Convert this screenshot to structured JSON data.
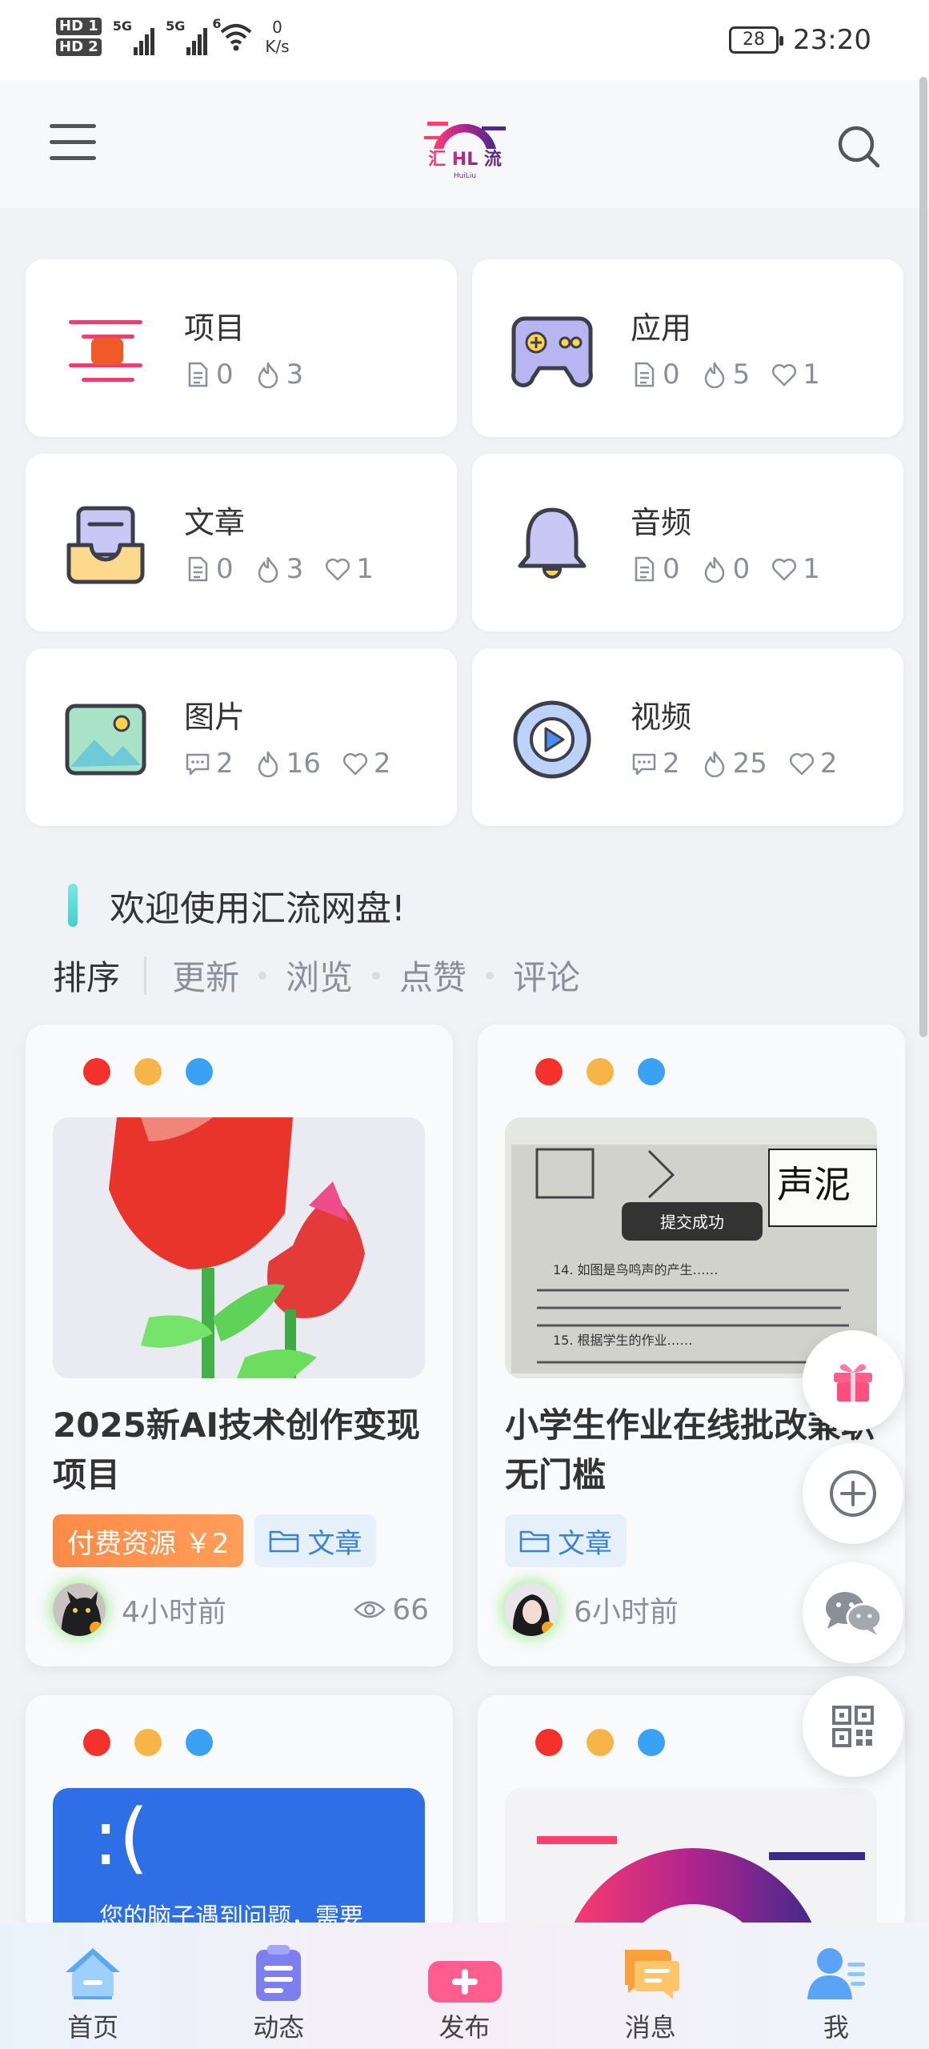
{
  "status_bar": {
    "sim1": "HD 1",
    "sim2": "HD 2",
    "network_1": "5G",
    "network_2": "5G",
    "wifi": "6",
    "net_speed_value": "0",
    "net_speed_unit": "K/s",
    "battery": "28",
    "time": "23:20"
  },
  "header": {
    "logo_text": "汇 HL 流",
    "logo_sub": "HuiLiu"
  },
  "categories": [
    {
      "title": "项目",
      "docs": "0",
      "hot": "3",
      "likes": null,
      "comments": null
    },
    {
      "title": "应用",
      "docs": "0",
      "hot": "5",
      "likes": "1",
      "comments": null
    },
    {
      "title": "文章",
      "docs": "0",
      "hot": "3",
      "likes": "1",
      "comments": null
    },
    {
      "title": "音频",
      "docs": "0",
      "hot": "0",
      "likes": "1",
      "comments": null
    },
    {
      "title": "图片",
      "docs": null,
      "hot": "16",
      "likes": "2",
      "comments": "2"
    },
    {
      "title": "视频",
      "docs": null,
      "hot": "25",
      "likes": "2",
      "comments": "2"
    }
  ],
  "welcome": "欢迎使用汇流网盘!",
  "sort": {
    "label": "排序",
    "options": [
      "更新",
      "浏览",
      "点赞",
      "评论"
    ]
  },
  "posts": [
    {
      "title": "2025新AI技术创作变现项目",
      "pay_tag": "付费资源 ￥2",
      "category_tag": "文章",
      "time": "4小时前",
      "views": "66"
    },
    {
      "title": "小学生作业在线批改兼职无门槛",
      "category_tag": "文章",
      "time": "6小时前",
      "thumb_toast": "提交成功",
      "thumb_stamp": "声泥",
      "thumb_text": [
        "14. 如图是鸟鸣声的产生……",
        "15. 根据学生的作业……"
      ]
    },
    {
      "thumb_text": "您的脑子遇到问题，需要"
    },
    {}
  ],
  "window_dots": [
    "#f4312b",
    "#f7b447",
    "#3aa2f5"
  ],
  "bottom_nav": [
    {
      "label": "首页",
      "icon": "home-icon"
    },
    {
      "label": "动态",
      "icon": "clipboard-icon"
    },
    {
      "label": "发布",
      "icon": "publish-plus-icon"
    },
    {
      "label": "消息",
      "icon": "message-icon"
    },
    {
      "label": "我",
      "icon": "user-icon"
    }
  ]
}
